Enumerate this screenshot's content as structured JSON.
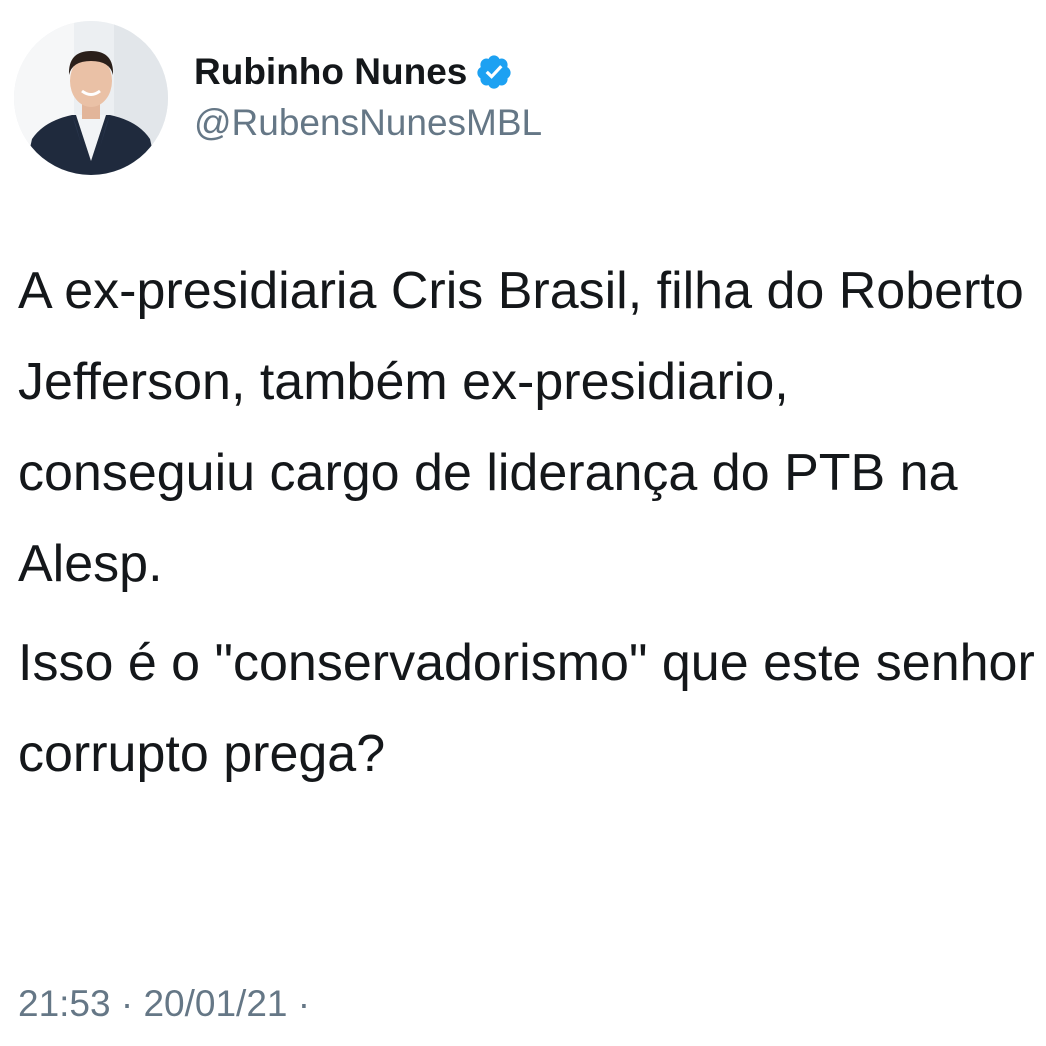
{
  "author": {
    "display_name": "Rubinho Nunes",
    "handle": "@RubensNunesMBL",
    "avatar_icon": "profile-photo",
    "verified_icon": "verified-badge-icon",
    "verified_color": "#1da1f2"
  },
  "tweet": {
    "paragraphs": [
      "A ex-presidiaria Cris Brasil, filha do Roberto Jefferson, também ex-presidiario, conseguiu cargo de liderança do PTB na Alesp.",
      "Isso é o \"conservadorismo\" que este senhor corrupto prega?"
    ]
  },
  "meta": {
    "time_date": "21:53 · 20/01/21 ·"
  },
  "colors": {
    "text": "#14171a",
    "secondary_text": "#657786",
    "background": "#ffffff"
  }
}
